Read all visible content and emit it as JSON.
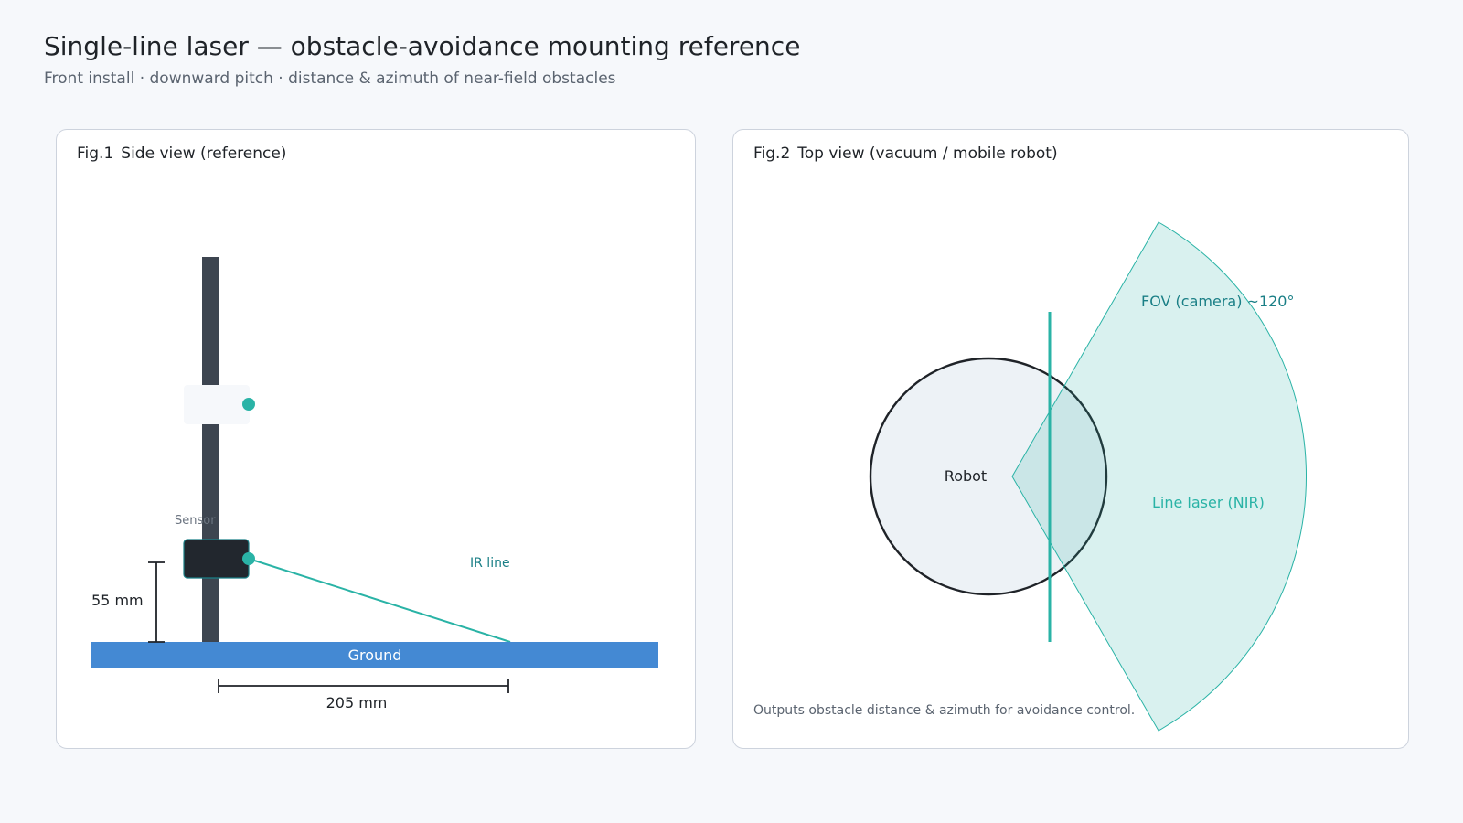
{
  "header": {
    "title": "Single-line laser — obstacle-avoidance mounting reference",
    "subtitle": "Front install · downward pitch · distance & azimuth of near-field obstacles"
  },
  "fig1": {
    "number": "Fig.1",
    "caption": "Side view (reference)",
    "sensor_label": "Sensor",
    "ir_label": "IR line",
    "ground_label": "Ground",
    "height_label": "55 mm",
    "distance_label": "205 mm"
  },
  "fig2": {
    "number": "Fig.2",
    "caption": "Top view (vacuum / mobile robot)",
    "robot_label": "Robot",
    "fov_label": "FOV (camera) ~120°",
    "laser_label": "Line laser (NIR)",
    "footnote": "Outputs obstacle distance & azimuth for avoidance control."
  },
  "colors": {
    "teal": "#2ab3a6",
    "teal_dark": "#1a7f86",
    "pole": "#3d4550",
    "sensor_body": "#22272e",
    "ground": "#4489d3",
    "robot_fill": "#edf2f6",
    "fov_fill": "#d6ebea"
  }
}
